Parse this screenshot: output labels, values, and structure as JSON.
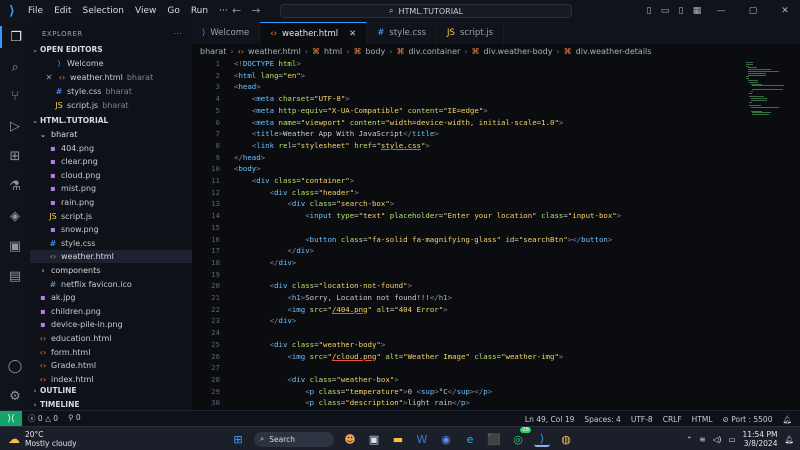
{
  "menu": [
    "File",
    "Edit",
    "Selection",
    "View",
    "Go",
    "Run"
  ],
  "more": "···",
  "search_label": "HTML.TUTORIAL",
  "sidebar": {
    "title": "EXPLORER",
    "open_editors": "OPEN EDITORS",
    "open_files": [
      {
        "name": "Welcome",
        "folder": "",
        "icon": "vscode"
      },
      {
        "name": "weather.html",
        "folder": "bharat",
        "icon": "html"
      },
      {
        "name": "style.css",
        "folder": "bharat",
        "icon": "css"
      },
      {
        "name": "script.js",
        "folder": "bharat",
        "icon": "js"
      }
    ],
    "workspace": "HTML.TUTORIAL",
    "tree": [
      {
        "name": "bharat",
        "type": "folder"
      },
      {
        "name": "404.png",
        "type": "img"
      },
      {
        "name": "clear.png",
        "type": "img"
      },
      {
        "name": "cloud.png",
        "type": "img"
      },
      {
        "name": "mist.png",
        "type": "img"
      },
      {
        "name": "rain.png",
        "type": "img"
      },
      {
        "name": "script.js",
        "type": "js"
      },
      {
        "name": "snow.png",
        "type": "img"
      },
      {
        "name": "style.css",
        "type": "css"
      },
      {
        "name": "weather.html",
        "type": "html"
      },
      {
        "name": "components",
        "type": "folder"
      },
      {
        "name": "netflix favicon.ico",
        "type": "css"
      },
      {
        "name": "ak.jpg",
        "type": "img"
      },
      {
        "name": "children.png",
        "type": "img"
      },
      {
        "name": "device-pile-in.png",
        "type": "img"
      },
      {
        "name": "education.html",
        "type": "html"
      },
      {
        "name": "form.html",
        "type": "html"
      },
      {
        "name": "Grade.html",
        "type": "html"
      },
      {
        "name": "index.html",
        "type": "html"
      }
    ],
    "outline": "OUTLINE",
    "timeline": "TIMELINE"
  },
  "tabs": [
    {
      "label": "Welcome",
      "icon": "vscode"
    },
    {
      "label": "weather.html",
      "icon": "html"
    },
    {
      "label": "style.css",
      "icon": "css"
    },
    {
      "label": "script.js",
      "icon": "js"
    }
  ],
  "breadcrumb": [
    "bharat",
    "weather.html",
    "html",
    "body",
    "div.container",
    "div.weather-body",
    "div.weather-details"
  ],
  "code": [
    "<!DOCTYPE html>",
    "<html lang=\"en\">",
    "<head>",
    "    <meta charset=\"UTF-8\">",
    "    <meta http-equiv=\"X-UA-Compatible\" content=\"IE=edge\">",
    "    <meta name=\"viewport\" content=\"width=device-width, initial-scale=1.0\">",
    "    <title>Weather App With JavaScript</title>",
    "    <link rel=\"stylesheet\" href=\"style.css\">",
    "</head>",
    "<body>",
    "    <div class=\"container\">",
    "        <div class=\"header\">",
    "            <div class=\"search-box\">",
    "                <input type=\"text\" placeholder=\"Enter your location\" class=\"input-box\">",
    "",
    "                <button class=\"fa-solid fa-magnifying-glass\" id=\"searchBtn\"></button>",
    "            </div>",
    "        </div>",
    "",
    "        <div class=\"location-not-found\">",
    "            <h1>Sorry, Location not found!!!</h1>",
    "            <img src=\"/404.png\" alt=\"404 Error\">",
    "        </div>",
    "",
    "        <div class=\"weather-body\">",
    "            <img src=\"/cloud.png\" alt=\"Weather Image\" class=\"weather-img\">",
    "",
    "            <div class=\"weather-box\">",
    "                <p class=\"temperature\">0 <sup>°C</sup></p>",
    "                <p class=\"description\">light rain</p>"
  ],
  "status": {
    "errors": "0",
    "warnings": "0",
    "info": "0",
    "position": "Ln 49, Col 19",
    "spaces": "Spaces: 4",
    "encoding": "UTF-8",
    "eol": "CRLF",
    "language": "HTML",
    "port": "Port : 5500"
  },
  "taskbar": {
    "temp": "20°C",
    "weather": "Mostly cloudy",
    "search": "Search",
    "time": "11:54 PM",
    "date": "3/8/2024",
    "badge": "28"
  }
}
